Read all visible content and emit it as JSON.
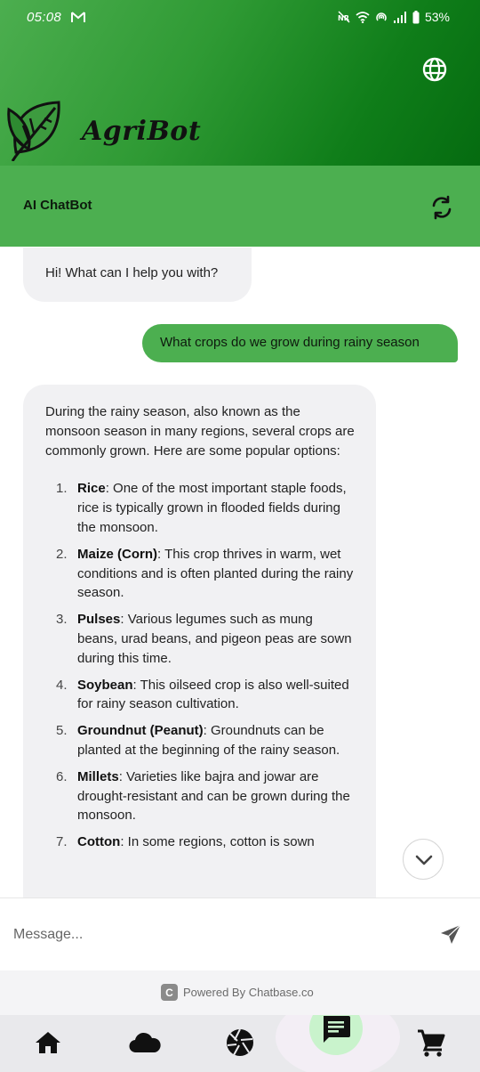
{
  "status_bar": {
    "time": "05:08",
    "battery": "53%"
  },
  "header": {
    "app_name": "AgriBot"
  },
  "chat": {
    "title": "AI ChatBot",
    "greeting": "Hi! What can I help you with?",
    "user_message": "What crops do we grow during rainy season",
    "answer_intro": "During the rainy season, also known as the monsoon season in many regions, several crops are commonly grown. Here are some popular options:",
    "answer_items": [
      {
        "num": "1.",
        "term": "Rice",
        "text": ": One of the most important staple foods, rice is typically grown in flooded fields during the monsoon."
      },
      {
        "num": "2.",
        "term": "Maize (Corn)",
        "text": ": This crop thrives in warm, wet conditions and is often planted during the rainy season."
      },
      {
        "num": "3.",
        "term": "Pulses",
        "text": ": Various legumes such as mung beans, urad beans, and pigeon peas are sown during this time."
      },
      {
        "num": "4.",
        "term": "Soybean",
        "text": ": This oilseed crop is also well-suited for rainy season cultivation."
      },
      {
        "num": "5.",
        "term": "Groundnut (Peanut)",
        "text": ": Groundnuts can be planted at the beginning of the rainy season."
      },
      {
        "num": "6.",
        "term": "Millets",
        "text": ": Varieties like bajra and jowar are drought-resistant and can be grown during the monsoon."
      },
      {
        "num": "7.",
        "term": "Cotton",
        "text": ": In some regions, cotton is sown"
      }
    ]
  },
  "input": {
    "placeholder": "Message..."
  },
  "footer": {
    "powered_by": "Powered By Chatbase.co",
    "logo_letter": "C"
  },
  "colors": {
    "header_dark": "#056b10",
    "header_light": "#4cae4f",
    "chat_bar": "#4caf50",
    "user_bubble": "#4caf50",
    "bot_bubble": "#f1f1f3",
    "active_nav": "#c9f3cc"
  },
  "nav": {
    "items": [
      "home-icon",
      "cloud-icon",
      "camera-aperture-icon",
      "chat-icon",
      "cart-icon"
    ],
    "active": "chat-icon"
  }
}
